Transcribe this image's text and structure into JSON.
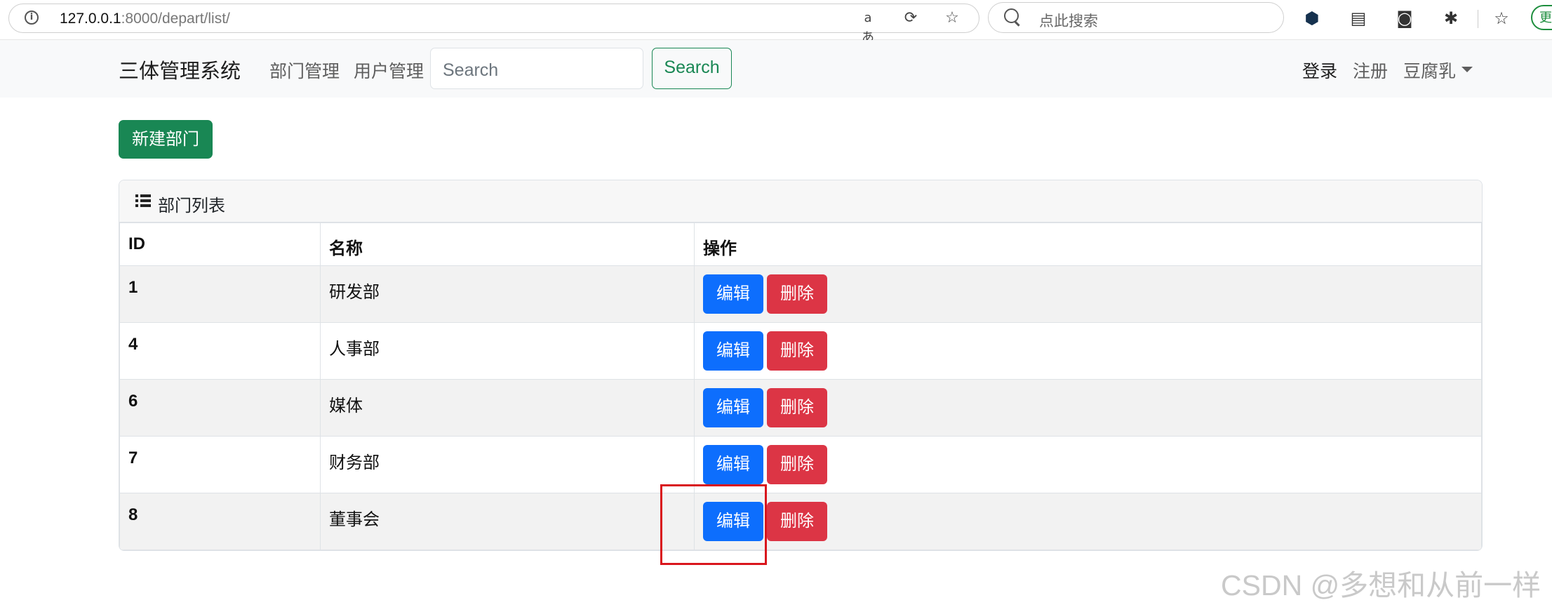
{
  "browser": {
    "url_host": "127.0.0.1",
    "url_path": ":8000/depart/list/",
    "search_placeholder": "点此搜索",
    "update_label": "更"
  },
  "navbar": {
    "brand": "三体管理系统",
    "links": [
      "部门管理",
      "用户管理"
    ],
    "search_placeholder": "Search",
    "search_button": "Search",
    "login": "登录",
    "register": "注册",
    "user": "豆腐乳"
  },
  "main": {
    "new_button": "新建部门",
    "panel_title": "部门列表",
    "columns": [
      "ID",
      "名称",
      "操作"
    ],
    "rows": [
      {
        "id": "1",
        "name": "研发部"
      },
      {
        "id": "4",
        "name": "人事部"
      },
      {
        "id": "6",
        "name": "媒体"
      },
      {
        "id": "7",
        "name": "财务部"
      },
      {
        "id": "8",
        "name": "董事会"
      }
    ],
    "edit_label": "编辑",
    "delete_label": "删除"
  },
  "watermark": "CSDN @多想和从前一样",
  "colors": {
    "success": "#198754",
    "primary": "#0d6efd",
    "danger": "#dc3545",
    "highlight": "#d9161d"
  }
}
